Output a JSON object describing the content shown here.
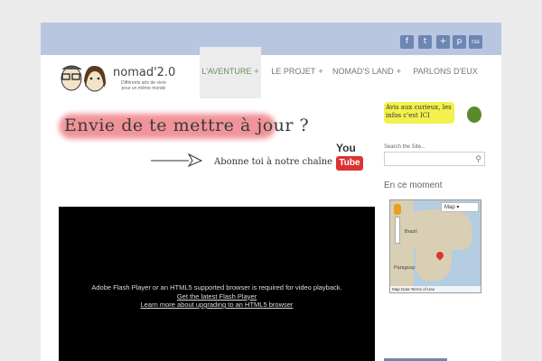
{
  "social": [
    "f",
    "t",
    "+",
    "p",
    "rss"
  ],
  "logo": {
    "title": "nomad'2.0",
    "tagline": "Différents arts de vivre pour un même monde"
  },
  "nav": [
    {
      "label": "L'AVENTURE",
      "plus": "+"
    },
    {
      "label": "LE PROJET",
      "plus": "+"
    },
    {
      "label": "NOMAD'S LAND",
      "plus": "+"
    },
    {
      "label": "PARLONS D'EUX",
      "plus": ""
    }
  ],
  "banner": {
    "title": "Envie de te mettre à jour ?",
    "subtitle": "Abonne toi à notre chaîne",
    "yt_you": "You",
    "yt_tube": "Tube"
  },
  "video": {
    "message": "Adobe Flash Player or an HTML5 supported browser is required for video playback.",
    "link1": "Get the latest Flash Player",
    "link2": "Learn more about upgrading to an HTML5 browser"
  },
  "sidebar": {
    "note": "Avis aux curieux, les infos c'est ICI",
    "search_label": "Search the Site...",
    "search_icon": "search-icon",
    "section_title": "En ce moment",
    "map": {
      "type_label": "Map",
      "labels": [
        "Brazil",
        "Paraguay"
      ],
      "footer": "Map Data   Terms of Use"
    }
  },
  "colors": {
    "topbar": "#b8c6e0",
    "social": "#6d86b3",
    "nav_active": "#6d8f5a"
  }
}
